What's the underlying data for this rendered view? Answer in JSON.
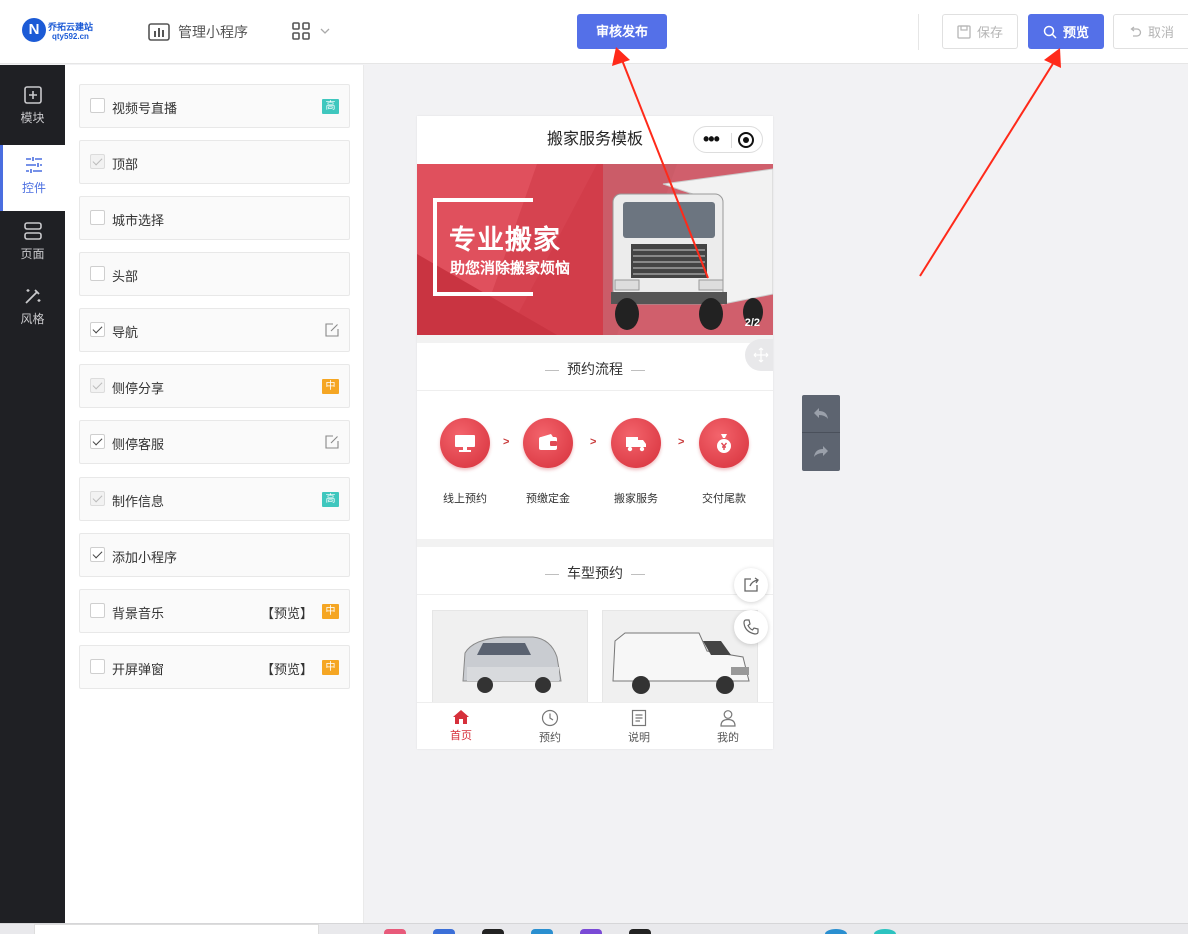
{
  "logo": {
    "name": "乔拓云建站",
    "domain": "qty592.cn"
  },
  "header": {
    "manage_label": "管理小程序",
    "publish_button": "审核发布",
    "save_button": "保存",
    "preview_button": "预览",
    "cancel_button": "取消"
  },
  "leftnav": [
    {
      "label": "模块",
      "icon": "plus-square-icon"
    },
    {
      "label": "控件",
      "icon": "sliders-icon",
      "active": true
    },
    {
      "label": "页面",
      "icon": "pages-icon"
    },
    {
      "label": "风格",
      "icon": "magic-wand-icon"
    }
  ],
  "controls": [
    {
      "label": "视频号直播",
      "checked": false,
      "disabled": false,
      "tag": "高"
    },
    {
      "label": "顶部",
      "checked": true,
      "disabled": true
    },
    {
      "label": "城市选择",
      "checked": false,
      "disabled": false
    },
    {
      "label": "头部",
      "checked": false,
      "disabled": false
    },
    {
      "label": "导航",
      "checked": true,
      "disabled": false,
      "edit": true
    },
    {
      "label": "侧停分享",
      "checked": true,
      "disabled": true,
      "tag": "中"
    },
    {
      "label": "侧停客服",
      "checked": true,
      "disabled": false,
      "edit": true
    },
    {
      "label": "制作信息",
      "checked": true,
      "disabled": true,
      "tag": "高"
    },
    {
      "label": "添加小程序",
      "checked": true,
      "disabled": false
    },
    {
      "label": "背景音乐",
      "checked": false,
      "disabled": false,
      "preview": "【预览】",
      "tag": "中"
    },
    {
      "label": "开屏弹窗",
      "checked": false,
      "disabled": false,
      "preview": "【预览】",
      "tag": "中"
    }
  ],
  "phone": {
    "title": "搬家服务模板",
    "banner": {
      "headline": "专业搬家",
      "subline": "助您消除搬家烦恼",
      "counter": "2/2"
    },
    "process": {
      "title": "预约流程",
      "steps": [
        {
          "label": "线上预约",
          "icon": "monitor-icon"
        },
        {
          "label": "预缴定金",
          "icon": "wallet-icon"
        },
        {
          "label": "搬家服务",
          "icon": "truck-icon"
        },
        {
          "label": "交付尾款",
          "icon": "money-bag-icon"
        }
      ],
      "separator": ">"
    },
    "vehicles": {
      "title": "车型预约"
    },
    "tabs": [
      {
        "label": "首页",
        "icon": "home-icon",
        "active": true
      },
      {
        "label": "预约",
        "icon": "clock-icon"
      },
      {
        "label": "说明",
        "icon": "document-icon"
      },
      {
        "label": "我的",
        "icon": "user-icon"
      }
    ]
  },
  "colors": {
    "primary": "#5470e8",
    "sidebar": "#1f2024",
    "accent_red": "#d6303b",
    "tag_high": "#3fc7be",
    "tag_mid": "#f5a623"
  }
}
